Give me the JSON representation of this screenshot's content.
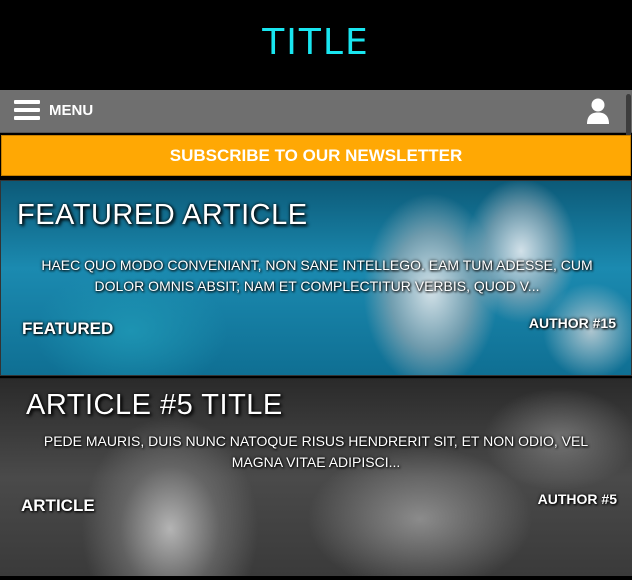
{
  "header": {
    "title": "TITLE",
    "title_color": "#19e6f0"
  },
  "nav": {
    "menu_label": "MENU",
    "menu_icon": "hamburger-icon",
    "user_icon": "user-icon"
  },
  "newsletter": {
    "label": "SUBSCRIBE TO OUR NEWSLETTER",
    "color": "#ffa804"
  },
  "articles": [
    {
      "title": "FEATURED ARTICLE",
      "excerpt": "HAEC QUO MODO CONVENIANT, NON SANE INTELLEGO. EAM TUM ADESSE, CUM DOLOR OMNIS ABSIT; NAM ET COMPLECTITUR VERBIS, QUOD V...",
      "tag": "FEATURED",
      "author": "AUTHOR #15"
    },
    {
      "title": "ARTICLE #5 TITLE",
      "excerpt": "PEDE MAURIS, DUIS NUNC NATOQUE RISUS HENDRERIT SIT, ET NON ODIO, VEL MAGNA VITAE ADIPISCI...",
      "tag": "ARTICLE",
      "author": "AUTHOR #5"
    }
  ]
}
